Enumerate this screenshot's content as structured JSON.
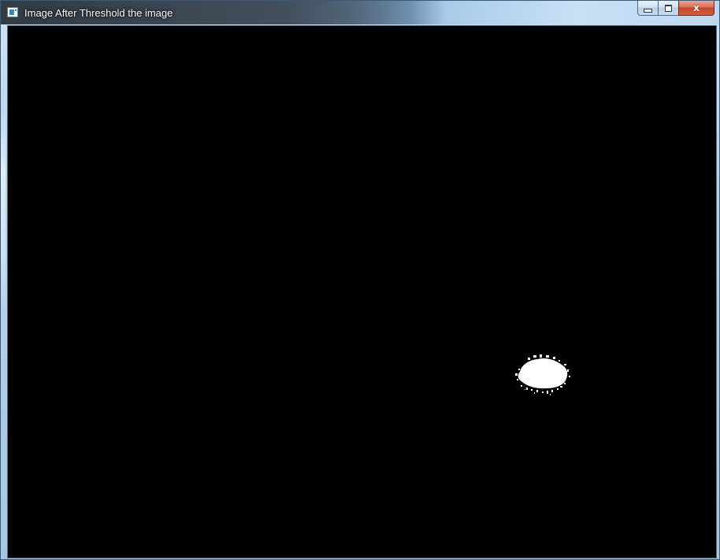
{
  "window": {
    "title": "Image After Threshold the image",
    "app_icon": "opencv-window-icon",
    "buttons": {
      "minimize": "minimize-icon",
      "maximize": "maximize-icon",
      "close": "close-icon",
      "close_glyph": "x"
    }
  },
  "image": {
    "background_color": "#000000",
    "blob_color": "#ffffff",
    "description_kind": "binary threshold image with single white blob"
  }
}
